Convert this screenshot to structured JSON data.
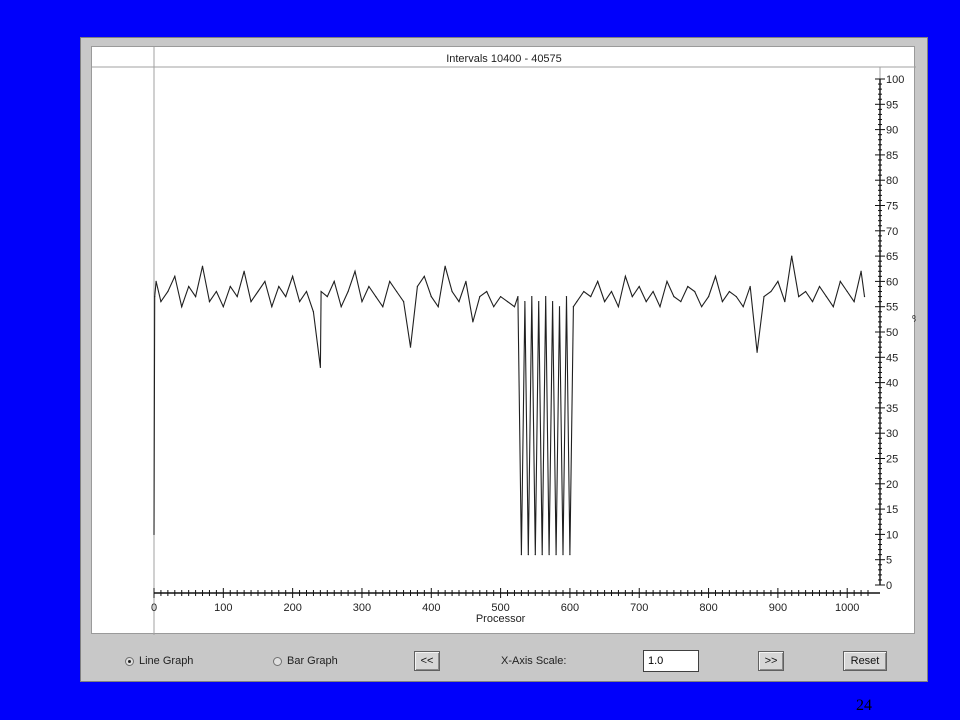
{
  "window": {
    "chart_title": "Intervals 10400 - 40575",
    "x_axis_label": "Processor",
    "y_axis_unit": "%"
  },
  "controls": {
    "line_graph_label": "Line Graph",
    "bar_graph_label": "Bar Graph",
    "scroll_left_label": "<<",
    "xaxis_scale_label": "X-Axis Scale:",
    "xaxis_scale_value": "1.0",
    "scroll_right_label": ">>",
    "reset_label": "Reset",
    "selected_mode": "Line Graph"
  },
  "slide": {
    "page_number": "24"
  },
  "colors": {
    "background": "#0000fb",
    "window": "#c8c8c8",
    "series": "#202020"
  },
  "chart_data": {
    "type": "line",
    "title": "Intervals 10400 - 40575",
    "xlabel": "Processor",
    "ylabel": "%",
    "xlim": [
      0,
      1030
    ],
    "ylim": [
      0,
      100
    ],
    "x_ticks": [
      0,
      100,
      200,
      300,
      400,
      500,
      600,
      700,
      800,
      900,
      1000
    ],
    "y_ticks": [
      0,
      5,
      10,
      15,
      20,
      25,
      30,
      35,
      40,
      45,
      50,
      55,
      60,
      65,
      70,
      75,
      80,
      85,
      90,
      95,
      100
    ],
    "grid": false,
    "series": [
      {
        "x": [
          0,
          1,
          3,
          10,
          20,
          30,
          40,
          50,
          60,
          70,
          80,
          90,
          100,
          110,
          120,
          130,
          140,
          150,
          160,
          170,
          180,
          190,
          200,
          210,
          220,
          230,
          240,
          241,
          250,
          260,
          270,
          280,
          290,
          300,
          310,
          320,
          330,
          340,
          350,
          360,
          370,
          380,
          390,
          400,
          410,
          420,
          430,
          440,
          450,
          460,
          470,
          480,
          490,
          500,
          510,
          520,
          525,
          530,
          535,
          540,
          545,
          550,
          555,
          560,
          565,
          570,
          575,
          580,
          585,
          590,
          595,
          600,
          605,
          610,
          620,
          630,
          640,
          650,
          660,
          670,
          680,
          690,
          700,
          710,
          720,
          730,
          740,
          750,
          760,
          770,
          780,
          790,
          800,
          810,
          820,
          830,
          840,
          850,
          860,
          870,
          880,
          890,
          900,
          910,
          920,
          930,
          940,
          950,
          960,
          970,
          980,
          990,
          1000,
          1010,
          1020,
          1025
        ],
        "y": [
          10,
          57,
          60,
          56,
          58,
          61,
          55,
          59,
          57,
          63,
          56,
          58,
          55,
          59,
          57,
          62,
          56,
          58,
          60,
          55,
          59,
          57,
          61,
          56,
          58,
          54,
          43,
          58,
          57,
          60,
          55,
          58,
          62,
          56,
          59,
          57,
          55,
          60,
          58,
          56,
          47,
          59,
          61,
          57,
          55,
          63,
          58,
          56,
          60,
          52,
          57,
          58,
          55,
          57,
          56,
          55,
          57,
          6,
          56,
          6,
          57,
          6,
          56,
          6,
          57,
          6,
          56,
          6,
          55,
          6,
          57,
          6,
          55,
          56,
          58,
          57,
          60,
          56,
          58,
          55,
          61,
          57,
          59,
          56,
          58,
          55,
          60,
          57,
          56,
          59,
          58,
          55,
          57,
          61,
          56,
          58,
          57,
          55,
          59,
          46,
          57,
          58,
          60,
          56,
          65,
          57,
          58,
          56,
          59,
          57,
          55,
          60,
          58,
          56,
          62,
          57
        ]
      }
    ]
  }
}
